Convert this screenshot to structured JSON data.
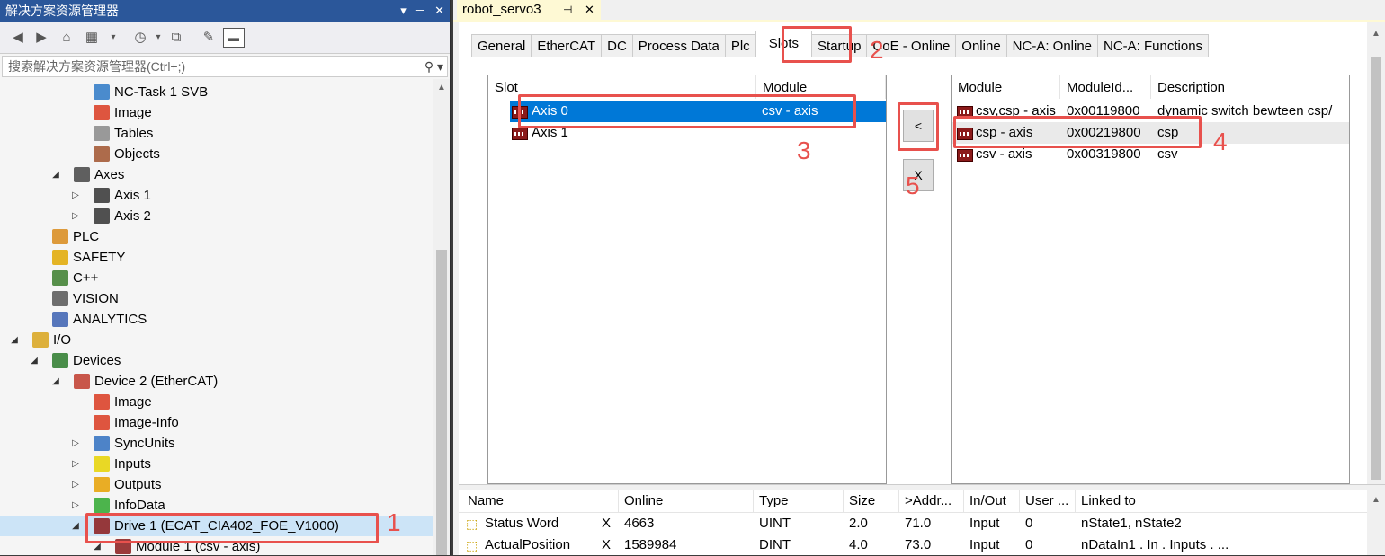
{
  "solution_explorer": {
    "title": "解决方案资源管理器",
    "title_buttons": [
      "▾",
      "⊣",
      "✕"
    ],
    "search_placeholder": "搜索解决方案资源管理器(Ctrl+;)",
    "tree": [
      {
        "label": "NC-Task 1 SVB",
        "icon": "task-icon",
        "expander": ""
      },
      {
        "label": "Image",
        "icon": "image-icon",
        "expander": ""
      },
      {
        "label": "Tables",
        "icon": "table-icon",
        "expander": ""
      },
      {
        "label": "Objects",
        "icon": "objects-icon",
        "expander": ""
      },
      {
        "label": "Axes",
        "icon": "axes-folder-icon",
        "expander": "◢"
      },
      {
        "label": "Axis 1",
        "icon": "axis-icon",
        "expander": "▷"
      },
      {
        "label": "Axis 2",
        "icon": "axis-icon",
        "expander": "▷"
      },
      {
        "label": "PLC",
        "icon": "plc-icon",
        "expander": ""
      },
      {
        "label": "SAFETY",
        "icon": "safety-icon",
        "expander": ""
      },
      {
        "label": "C++",
        "icon": "cpp-icon",
        "expander": ""
      },
      {
        "label": "VISION",
        "icon": "vision-icon",
        "expander": ""
      },
      {
        "label": "ANALYTICS",
        "icon": "analytics-icon",
        "expander": ""
      },
      {
        "label": "I/O",
        "icon": "io-icon",
        "expander": "◢"
      },
      {
        "label": "Devices",
        "icon": "devices-icon",
        "expander": "◢"
      },
      {
        "label": "Device 2 (EtherCAT)",
        "icon": "ethercat-device-icon",
        "expander": "◢"
      },
      {
        "label": "Image",
        "icon": "image-icon",
        "expander": ""
      },
      {
        "label": "Image-Info",
        "icon": "image-icon",
        "expander": ""
      },
      {
        "label": "SyncUnits",
        "icon": "sync-icon",
        "expander": "▷"
      },
      {
        "label": "Inputs",
        "icon": "inputs-icon",
        "expander": "▷"
      },
      {
        "label": "Outputs",
        "icon": "outputs-icon",
        "expander": "▷"
      },
      {
        "label": "InfoData",
        "icon": "infodata-icon",
        "expander": "▷"
      },
      {
        "label": "Drive 1 (ECAT_CIA402_FOE_V1000)",
        "icon": "drive-icon",
        "expander": "◢"
      },
      {
        "label": "Module 1 (csv -  axis)",
        "icon": "module-icon",
        "expander": "◢"
      }
    ]
  },
  "document": {
    "tab_title": "robot_servo3",
    "tab_pin": "⊣",
    "tab_close": "✕",
    "tabs": [
      "General",
      "EtherCAT",
      "DC",
      "Process Data",
      "Plc",
      "Slots",
      "Startup",
      "CoE - Online",
      "Online",
      "NC-A: Online",
      "NC-A: Functions"
    ],
    "active_tab": "Slots"
  },
  "slots": {
    "headers": [
      "Slot",
      "Module"
    ],
    "rows": [
      {
        "slot": "Axis 0",
        "module": "csv -  axis"
      },
      {
        "slot": "Axis 1",
        "module": ""
      }
    ]
  },
  "buttons": {
    "insert": "<",
    "remove": "X"
  },
  "modules": {
    "headers": [
      "Module",
      "ModuleId...",
      "Description"
    ],
    "rows": [
      {
        "module": "csv,csp - axis",
        "id": "0x00119800",
        "desc": "dynamic switch bewteen csp/"
      },
      {
        "module": "csp - axis",
        "id": "0x00219800",
        "desc": "csp"
      },
      {
        "module": "csv -  axis",
        "id": "0x00319800",
        "desc": "csv"
      }
    ]
  },
  "variables": {
    "headers": [
      "Name",
      "Online",
      "Type",
      "Size",
      ">Addr...",
      "In/Out",
      "User ...",
      "Linked to"
    ],
    "rows": [
      {
        "name": "Status Word",
        "x": "X",
        "online": "4663",
        "type": "UINT",
        "size": "2.0",
        "addr": "71.0",
        "inout": "Input",
        "user": "0",
        "linked": "nState1, nState2"
      },
      {
        "name": "ActualPosition",
        "x": "X",
        "online": "1589984",
        "type": "DINT",
        "size": "4.0",
        "addr": "73.0",
        "inout": "Input",
        "user": "0",
        "linked": "nDataIn1 . In . Inputs . ..."
      }
    ]
  },
  "annotations": [
    "1",
    "2",
    "3",
    "4",
    "5"
  ],
  "colors": {
    "accent": "#2b579a",
    "selection": "#0078d7",
    "highlight": "#e8514d",
    "doc_tab": "#fef9d4"
  }
}
